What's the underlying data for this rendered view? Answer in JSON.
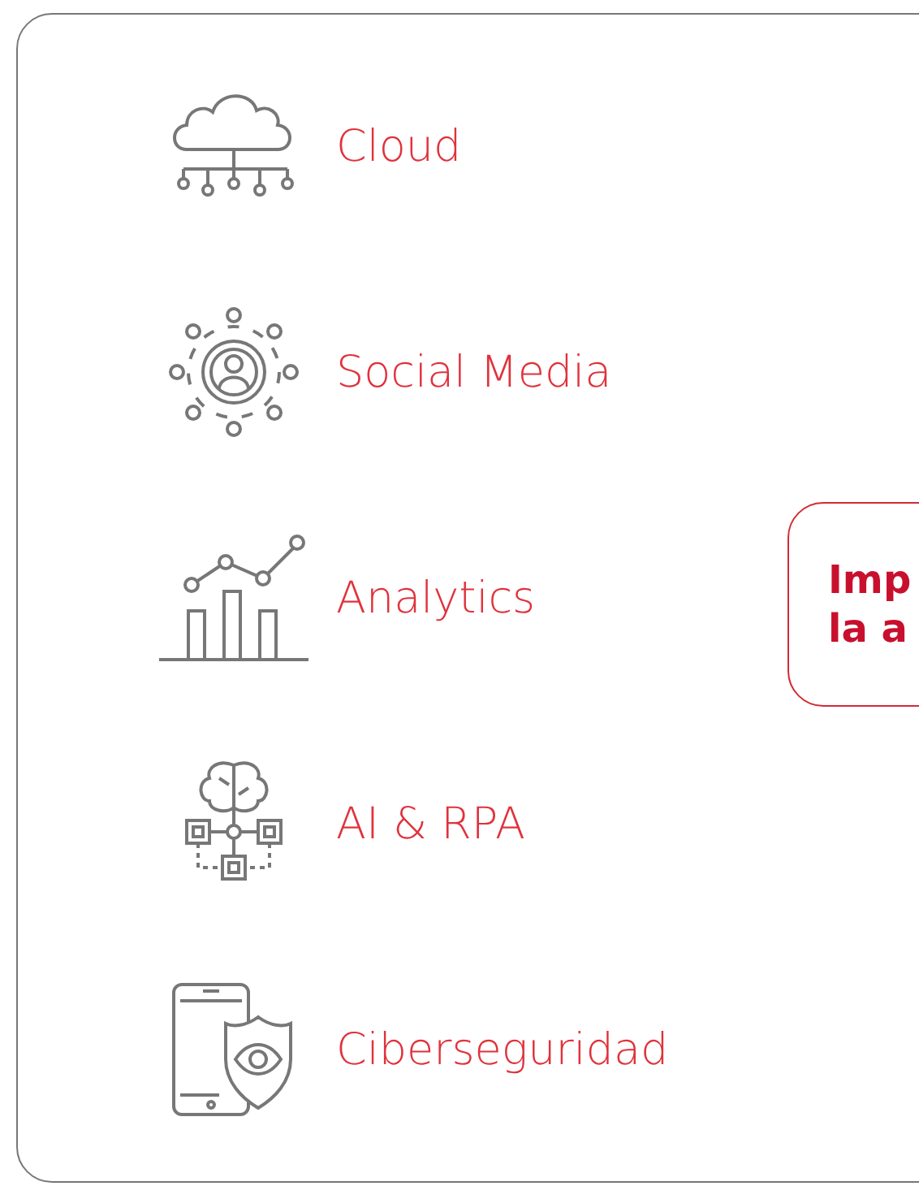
{
  "services": [
    {
      "kind": "cloud",
      "label": "Cloud"
    },
    {
      "kind": "social",
      "label": "Social Media"
    },
    {
      "kind": "analytics",
      "label": "Analytics"
    },
    {
      "kind": "ai",
      "label": "AI & RPA"
    },
    {
      "kind": "security",
      "label": "Ciberseguridad"
    }
  ],
  "callout": {
    "lines": [
      "Imp",
      "la a"
    ]
  }
}
